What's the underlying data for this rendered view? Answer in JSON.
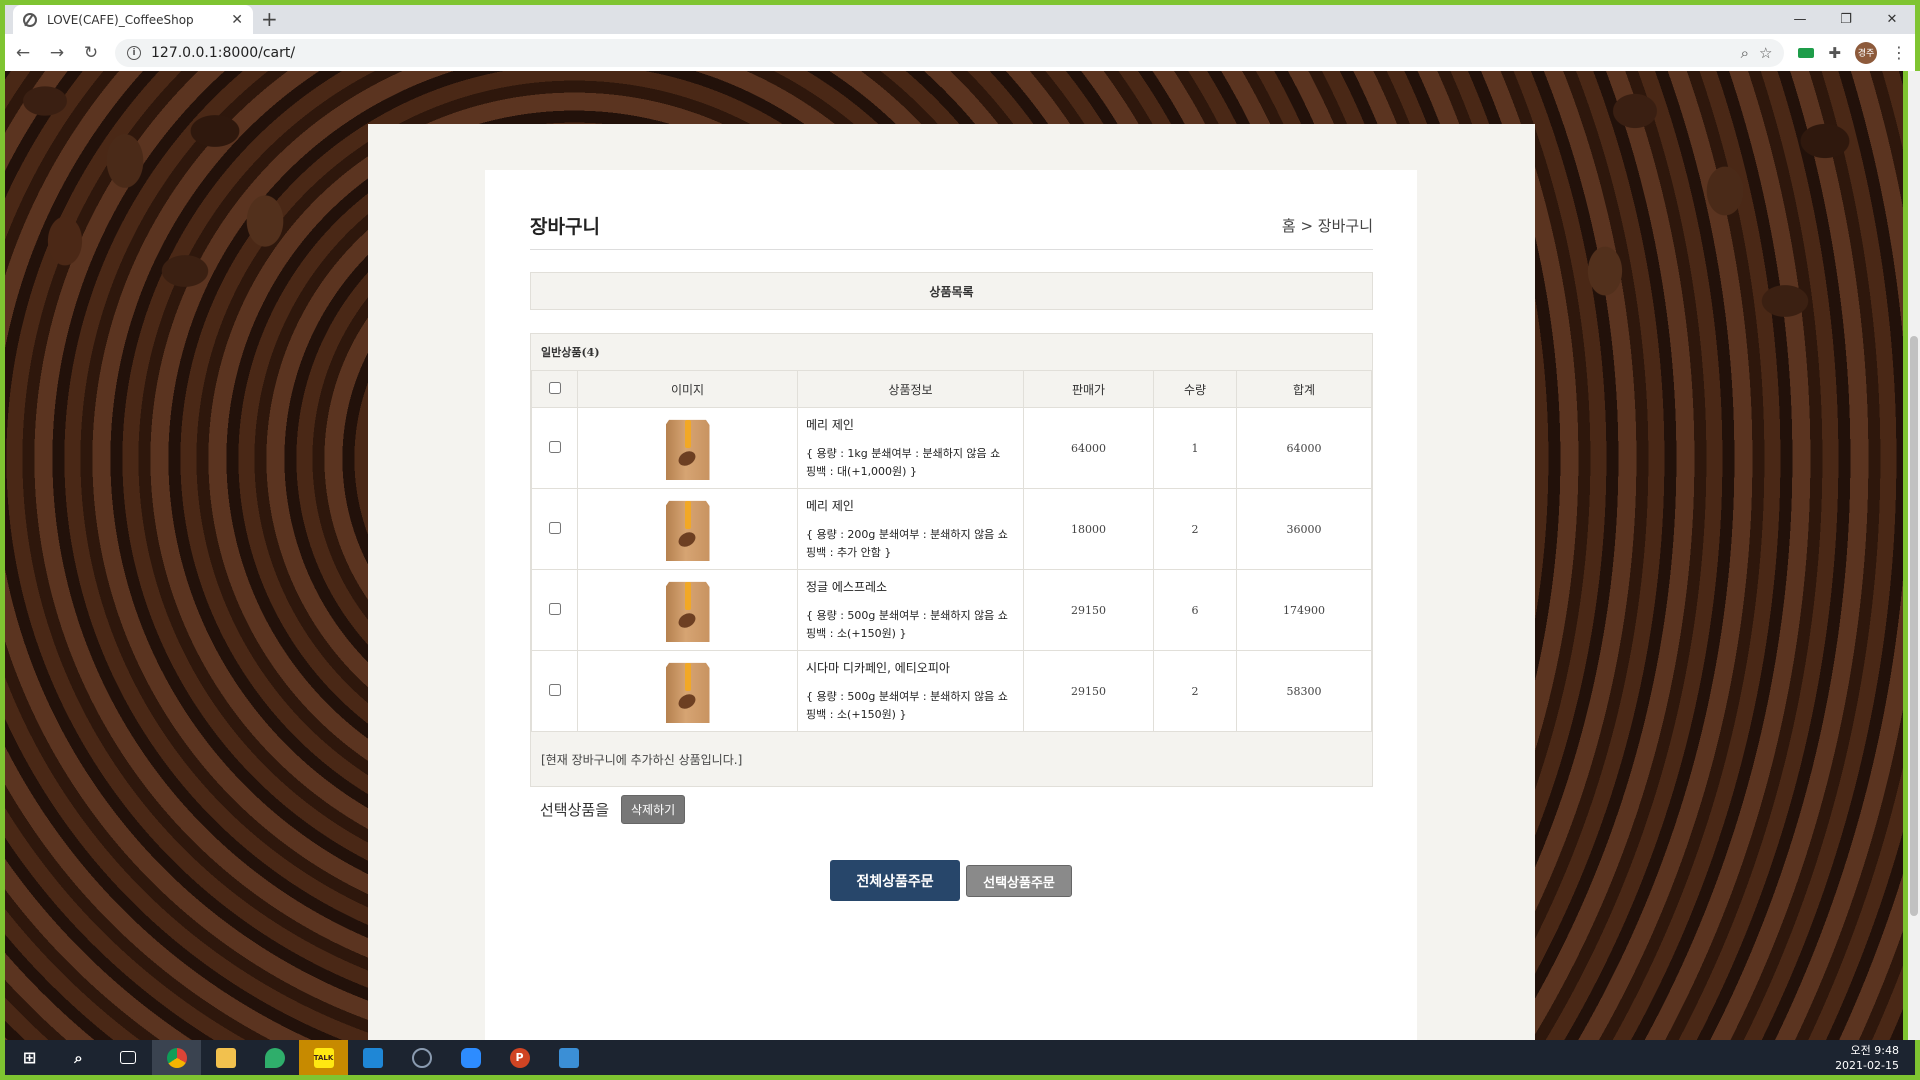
{
  "browser": {
    "tab_title": "LOVE(CAFE)_CoffeeShop",
    "url": "127.0.0.1:8000/cart/",
    "profile_initials": "경주"
  },
  "page": {
    "title": "장바구니",
    "breadcrumb": "홈 > 장바구니",
    "section_label": "상품목록",
    "group_label": "일반상품(4)",
    "columns": [
      "이미지",
      "상품정보",
      "판매가",
      "수량",
      "합계"
    ],
    "items": [
      {
        "name": "메리 제인",
        "option_line1": "{ 용량 : 1kg 분쇄여부 : 분쇄하지 않음 쇼",
        "option_line2": "핑백 : 대(+1,000원) }",
        "price": "64000",
        "qty": "1",
        "total": "64000"
      },
      {
        "name": "메리 제인",
        "option_line1": "{ 용량 : 200g 분쇄여부 : 분쇄하지 않음 쇼",
        "option_line2": "핑백 : 추가 안함 }",
        "price": "18000",
        "qty": "2",
        "total": "36000"
      },
      {
        "name": "정글 에스프레소",
        "option_line1": "{ 용량 : 500g 분쇄여부 : 분쇄하지 않음 쇼",
        "option_line2": "핑백 : 소(+150원) }",
        "price": "29150",
        "qty": "6",
        "total": "174900"
      },
      {
        "name": "시다마 디카페인, 에티오피아",
        "option_line1": "{ 용량 : 500g 분쇄여부 : 분쇄하지 않음 쇼",
        "option_line2": "핑백 : 소(+150원) }",
        "price": "29150",
        "qty": "2",
        "total": "58300"
      }
    ],
    "cart_note": "[현재 장바구니에 추가하신 상품입니다.]",
    "selected_label": "선택상품을",
    "delete_button": "삭제하기",
    "order_all_button": "전체상품주문",
    "order_selected_button": "선택상품주문"
  },
  "taskbar": {
    "time": "오전 9:48",
    "date": "2021-02-15"
  },
  "colors": {
    "primary_button": "#27466a",
    "secondary_button": "#8a8a8a",
    "panel_bg": "#f4f3ef"
  }
}
